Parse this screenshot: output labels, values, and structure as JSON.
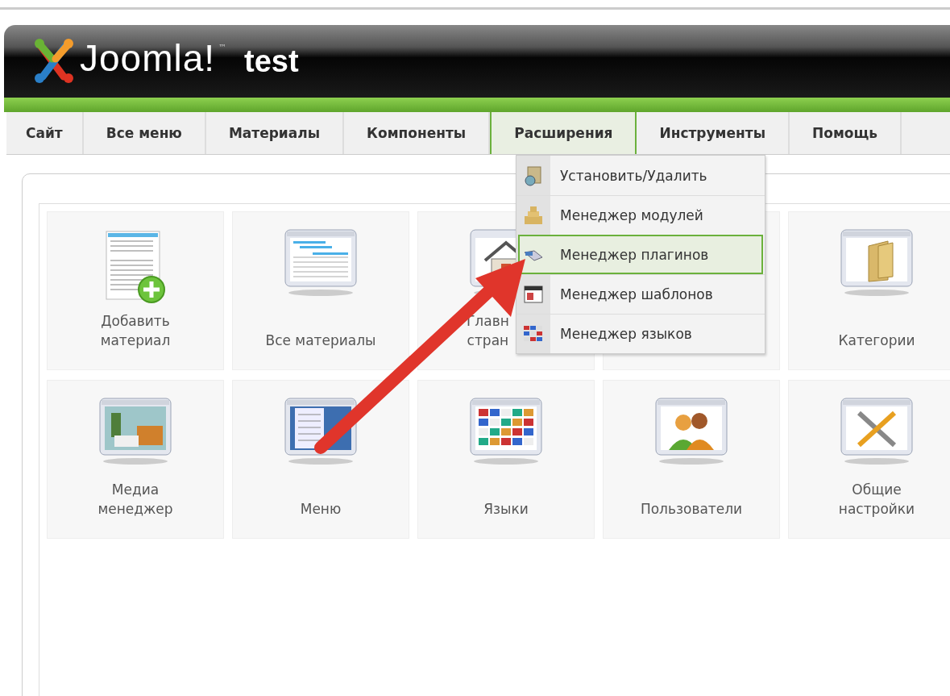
{
  "header": {
    "logo_text": "Joomla!",
    "trademark": "™",
    "site_name": "test"
  },
  "menu": [
    {
      "label": "Сайт",
      "selected": false
    },
    {
      "label": "Все меню",
      "selected": false
    },
    {
      "label": "Материалы",
      "selected": false
    },
    {
      "label": "Компоненты",
      "selected": false
    },
    {
      "label": "Расширения",
      "selected": true
    },
    {
      "label": "Инструменты",
      "selected": false
    },
    {
      "label": "Помощь",
      "selected": false
    }
  ],
  "dropdown": [
    {
      "label": "Установить/Удалить",
      "kind": "installer",
      "selected": false
    },
    {
      "label": "Менеджер модулей",
      "kind": "modules",
      "selected": false
    },
    {
      "label": "Менеджер плагинов",
      "kind": "plugins",
      "selected": true
    },
    {
      "label": "Менеджер шаблонов",
      "kind": "templates",
      "selected": false
    },
    {
      "label": "Менеджер языков",
      "kind": "languages",
      "selected": false
    }
  ],
  "cards": [
    {
      "label": "Добавить\nматериал",
      "kind": "add-article"
    },
    {
      "label": "Все материалы",
      "kind": "articles"
    },
    {
      "label": "Главн\nстран",
      "kind": "home"
    },
    {
      "kind": "covered"
    },
    {
      "label": "Категории",
      "kind": "categories"
    },
    {
      "label": "Медиа\nменеджер",
      "kind": "media"
    },
    {
      "label": "Меню",
      "kind": "menus"
    },
    {
      "label": "Языки",
      "kind": "languages"
    },
    {
      "label": "Пользователи",
      "kind": "users"
    },
    {
      "label": "Общие\nнастройки",
      "kind": "settings"
    }
  ]
}
